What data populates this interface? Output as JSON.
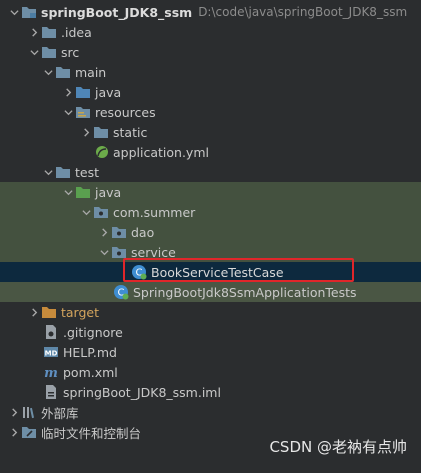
{
  "project": {
    "name": "springBoot_JDK8_ssm",
    "path": "D:\\code\\java\\springBoot_JDK8_ssm"
  },
  "tree": {
    "idea": ".idea",
    "src": "src",
    "main": "main",
    "main_java": "java",
    "resources": "resources",
    "static": "static",
    "application_yml": "application.yml",
    "test": "test",
    "test_java": "java",
    "package": "com.summer",
    "dao": "dao",
    "service": "service",
    "book_test": "BookServiceTestCase",
    "app_tests": "SpringBootJdk8SsmApplicationTests",
    "target": "target",
    "gitignore": ".gitignore",
    "help": "HELP.md",
    "pom": "pom.xml",
    "iml": "springBoot_JDK8_ssm.iml",
    "external_libs": "外部库",
    "scratches": "临时文件和控制台"
  },
  "watermark": "CSDN @老衲有点帅",
  "colors": {
    "folder_blue": "#6e8ea6",
    "folder_orange": "#c78b3c",
    "selection": "#0d293e",
    "test_green": "#44513f",
    "highlight_red": "#e0262a",
    "spring_green": "#6cab4a"
  }
}
